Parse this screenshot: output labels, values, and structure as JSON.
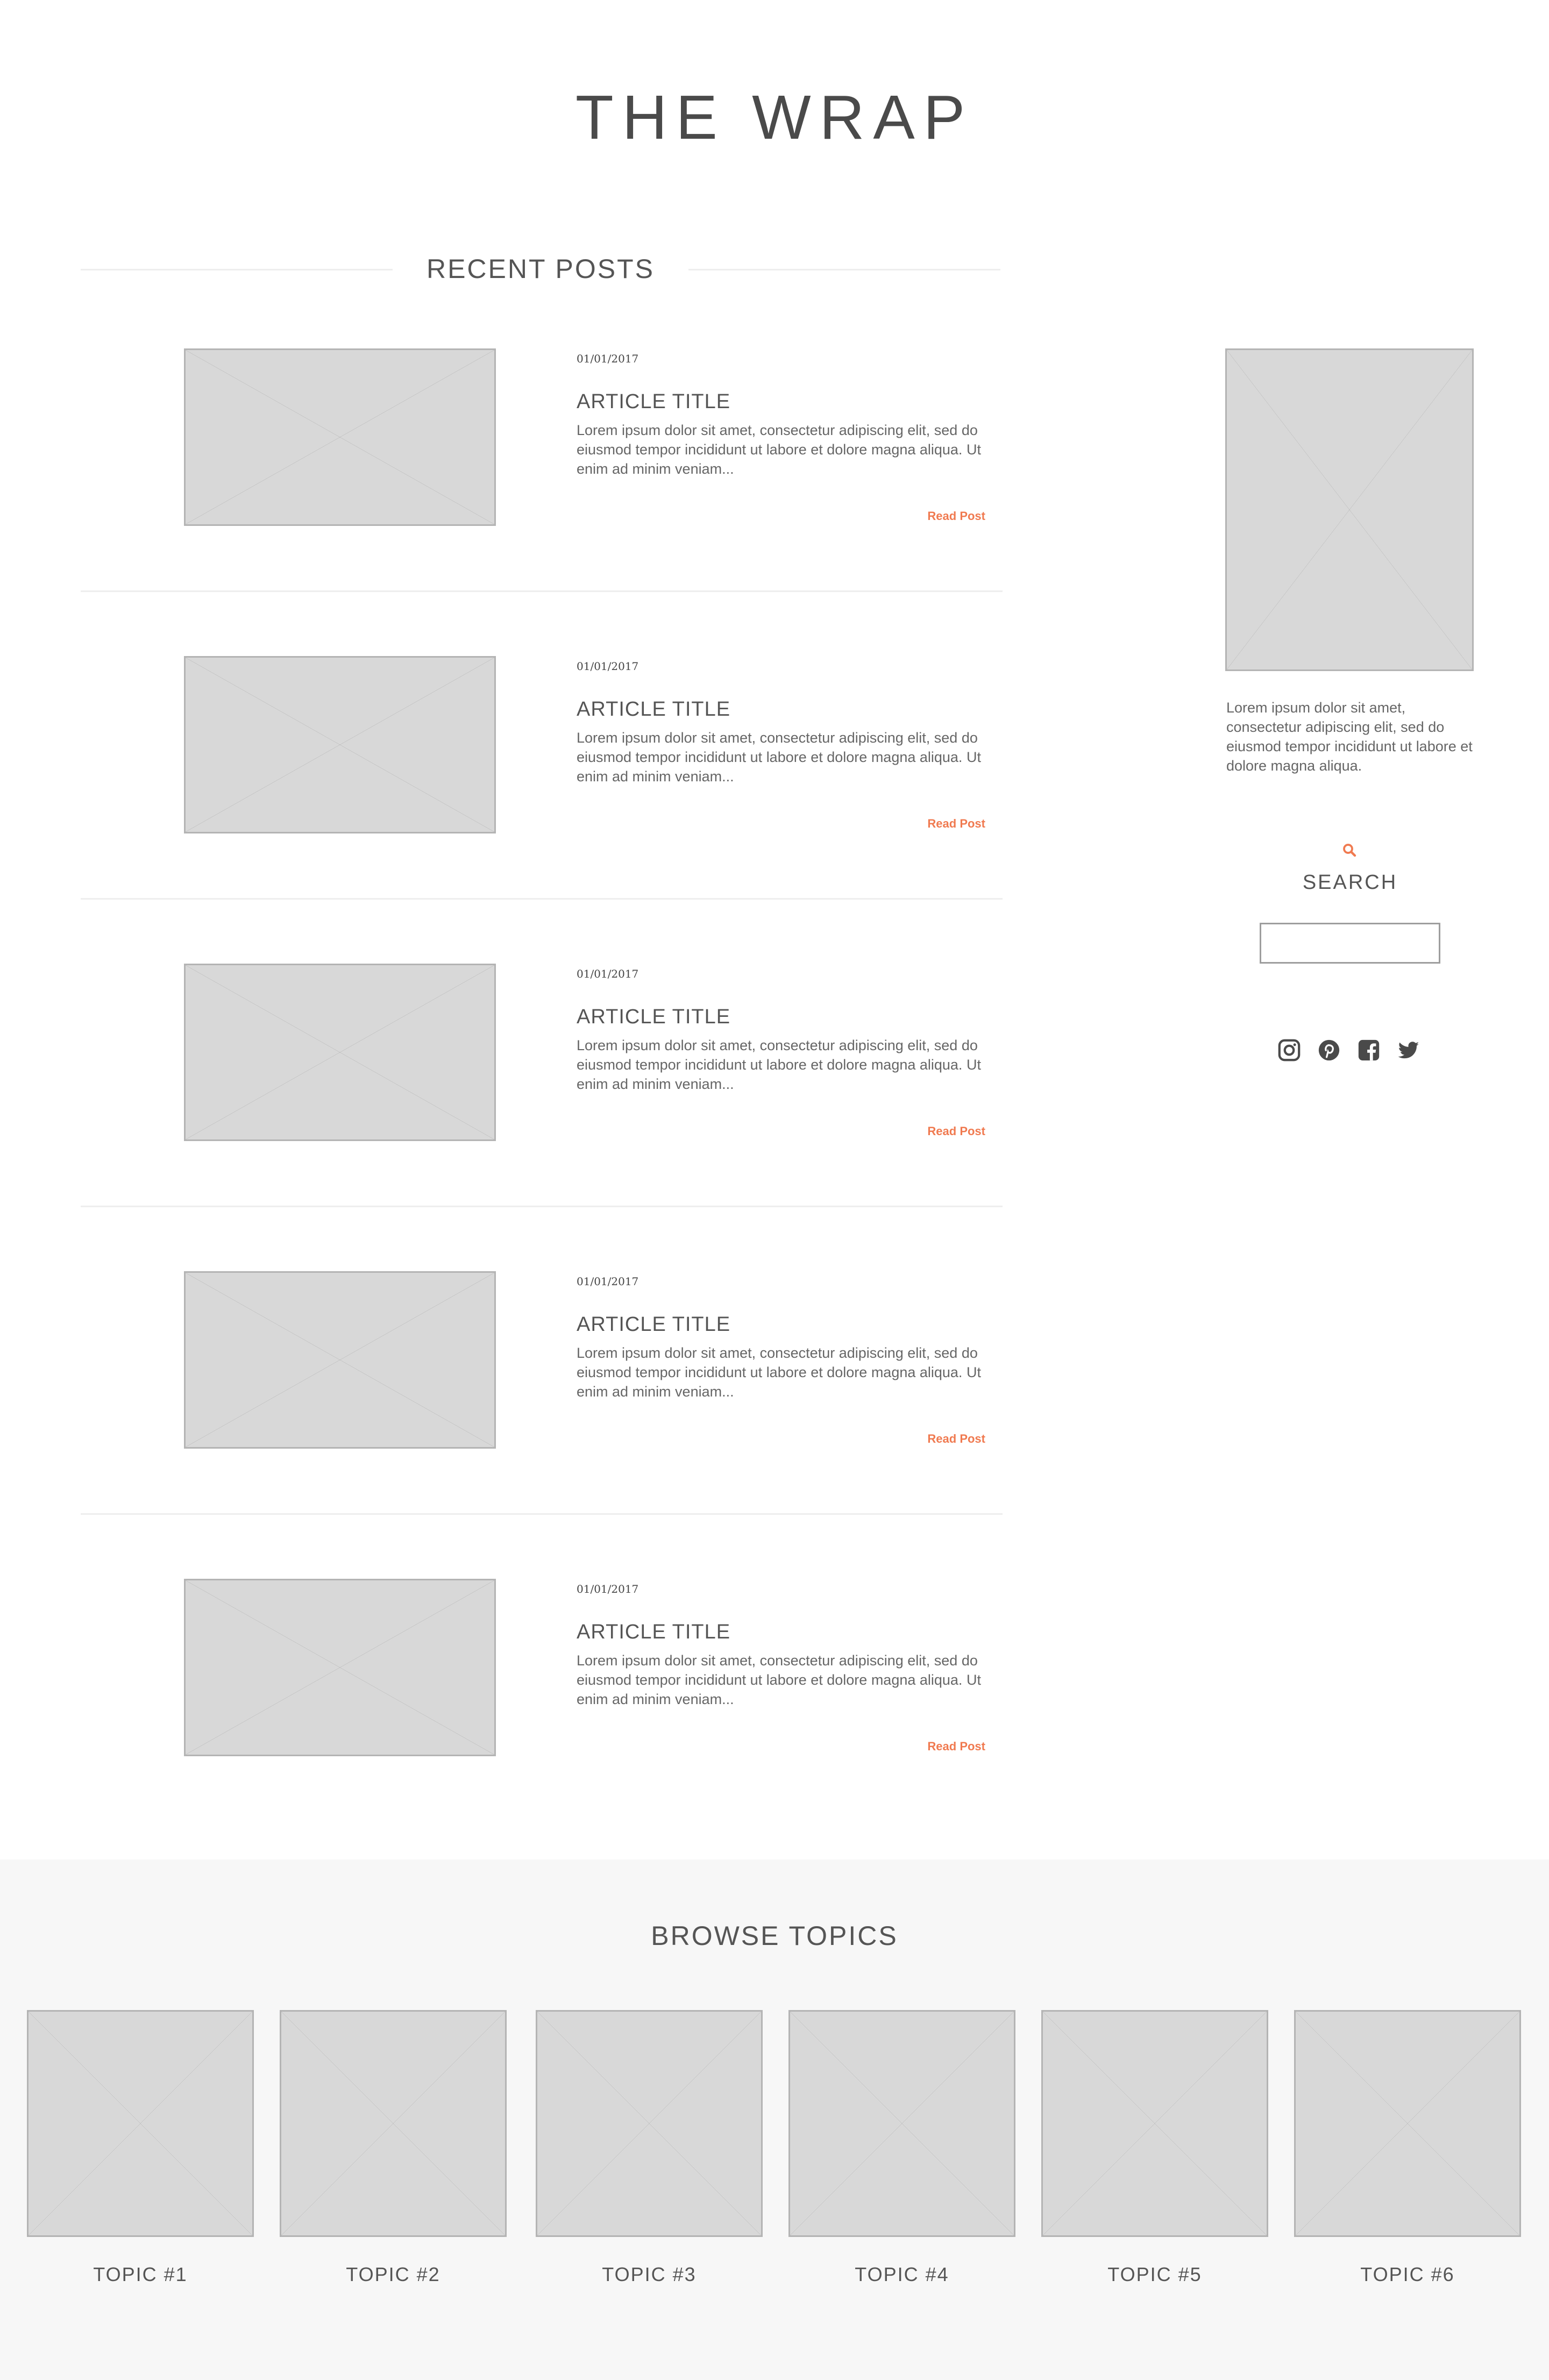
{
  "site": {
    "title": "THE WRAP"
  },
  "recent_posts": {
    "heading": "RECENT POSTS",
    "posts": [
      {
        "date": "01/01/2017",
        "title": "ARTICLE TITLE",
        "excerpt": "Lorem ipsum dolor sit amet, consectetur adipiscing elit, sed do eiusmod tempor incididunt ut labore et dolore magna aliqua. Ut enim ad minim veniam...",
        "link": "Read Post"
      },
      {
        "date": "01/01/2017",
        "title": "ARTICLE TITLE",
        "excerpt": "Lorem ipsum dolor sit amet, consectetur adipiscing elit, sed do eiusmod tempor incididunt ut labore et dolore magna aliqua. Ut enim ad minim veniam...",
        "link": "Read Post"
      },
      {
        "date": "01/01/2017",
        "title": "ARTICLE TITLE",
        "excerpt": "Lorem ipsum dolor sit amet, consectetur adipiscing elit, sed do eiusmod tempor incididunt ut labore et dolore magna aliqua. Ut enim ad minim veniam...",
        "link": "Read Post"
      },
      {
        "date": "01/01/2017",
        "title": "ARTICLE TITLE",
        "excerpt": "Lorem ipsum dolor sit amet, consectetur adipiscing elit, sed do eiusmod tempor incididunt ut labore et dolore magna aliqua. Ut enim ad minim veniam...",
        "link": "Read Post"
      },
      {
        "date": "01/01/2017",
        "title": "ARTICLE TITLE",
        "excerpt": "Lorem ipsum dolor sit amet, consectetur adipiscing elit, sed do eiusmod tempor incididunt ut labore et dolore magna aliqua. Ut enim ad minim veniam...",
        "link": "Read Post"
      }
    ]
  },
  "sidebar": {
    "about_text": "Lorem ipsum dolor sit amet, consectetur adipiscing elit, sed do eiusmod tempor incididunt ut labore et dolore magna aliqua.",
    "search": {
      "label": "SEARCH",
      "icon": "search-icon",
      "placeholder": "",
      "value": ""
    },
    "social": [
      {
        "name": "instagram-icon"
      },
      {
        "name": "pinterest-icon"
      },
      {
        "name": "facebook-icon"
      },
      {
        "name": "twitter-icon"
      }
    ]
  },
  "browse_topics": {
    "heading": "BROWSE TOPICS",
    "topics": [
      {
        "label": "TOPIC #1"
      },
      {
        "label": "TOPIC #2"
      },
      {
        "label": "TOPIC #3"
      },
      {
        "label": "TOPIC #4"
      },
      {
        "label": "TOPIC #5"
      },
      {
        "label": "TOPIC #6"
      }
    ]
  },
  "colors": {
    "accent": "#f07a50",
    "text": "#555555",
    "placeholder_fill": "#d8d8d8",
    "placeholder_stroke": "#b4b4b4",
    "footer_bg": "#f7f7f7"
  }
}
